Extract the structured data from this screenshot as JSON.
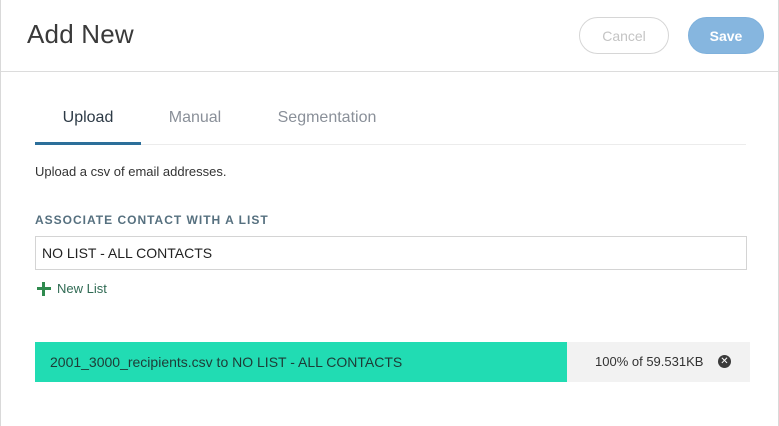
{
  "dialog": {
    "title": "Add New",
    "cancel_label": "Cancel",
    "save_label": "Save"
  },
  "tabs": [
    {
      "label": "Upload",
      "active": true
    },
    {
      "label": "Manual",
      "active": false
    },
    {
      "label": "Segmentation",
      "active": false
    }
  ],
  "upload": {
    "description": "Upload a csv of email addresses.",
    "associate_label": "ASSOCIATE CONTACT WITH A LIST",
    "selected_list": "NO LIST - ALL CONTACTS",
    "new_list_label": "New List",
    "file_status": "2001_3000_recipients.csv to NO LIST - ALL CONTACTS",
    "progress_text": "100% of 59.531KB",
    "progress_percent": 100
  },
  "colors": {
    "accent": "#2c6f9a",
    "progress_fill": "#21dcb3",
    "save_button": "#86b6df",
    "new_list_icon": "#2f8a4e"
  },
  "icons": {
    "new_list": "plus-icon",
    "remove_upload": "close-circle-icon"
  }
}
